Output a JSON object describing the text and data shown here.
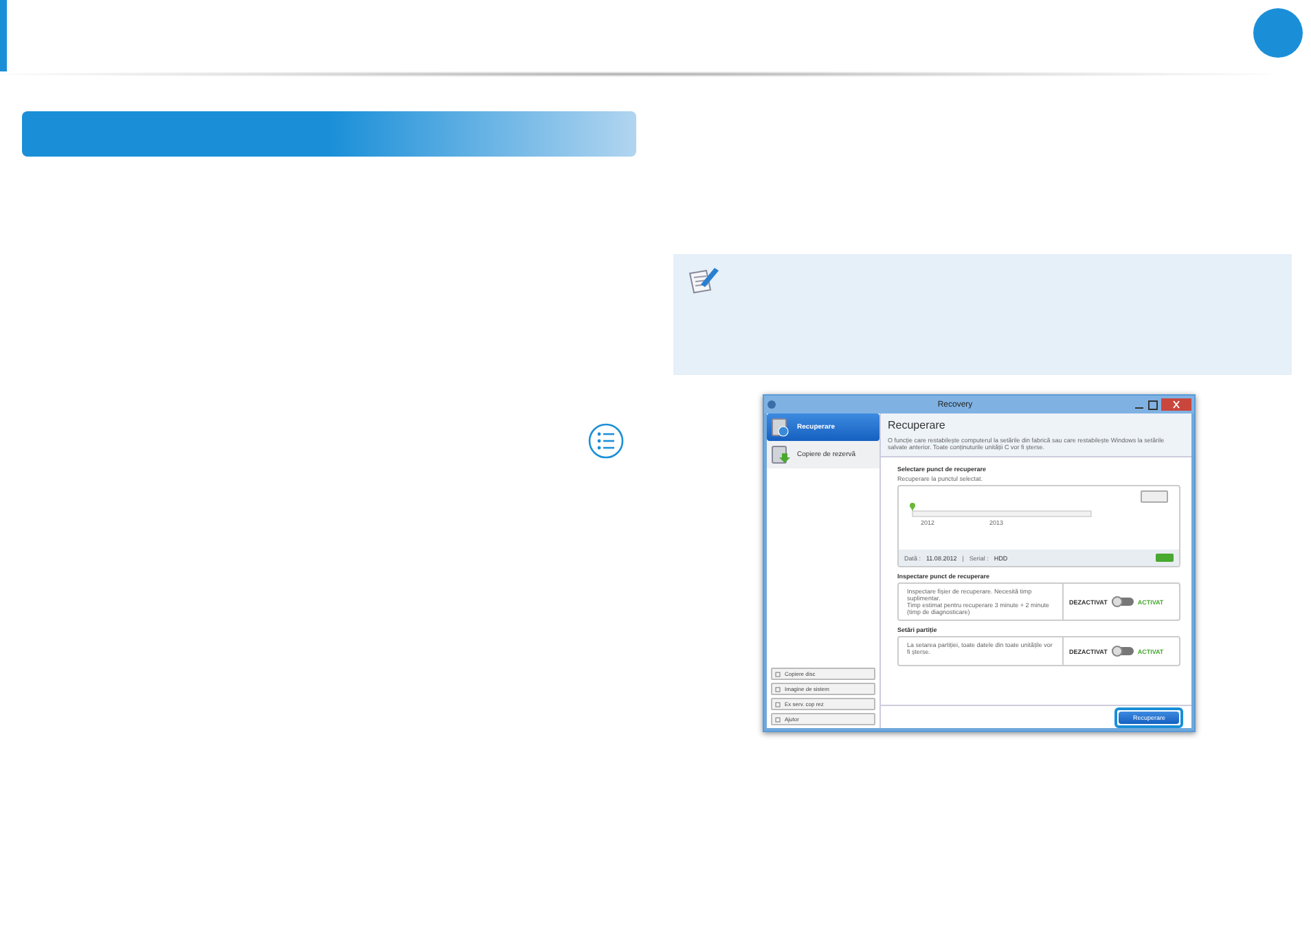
{
  "window": {
    "title": "Recovery"
  },
  "sidebar": {
    "items": [
      {
        "label": "Recuperare",
        "selected": true
      },
      {
        "label": "Copiere de rezervă",
        "selected": false
      }
    ],
    "buttons": [
      "Copiere disc",
      "Imagine de sistem",
      "Ex serv. cop rez",
      "Ajutor"
    ]
  },
  "header": {
    "title": "Recuperare",
    "description": "O funcție care restabilește computerul la setările din fabrică sau care restabilește Windows la setările salvate anterior. Toate conținuturile unității C vor fi șterse."
  },
  "restore_point": {
    "title": "Selectare punct de recuperare",
    "subtitle": "Recuperare la punctul selectat.",
    "years": [
      "2012",
      "2013"
    ],
    "date_label": "Dată :",
    "date": "11.08.2012",
    "separator": "|",
    "level": 0,
    "serial_label": "Serial :",
    "serial": "HDD"
  },
  "options": [
    {
      "title": "Inspectare punct de recuperare",
      "text": "Inspectare fișier de recuperare. Necesită timp suplimentar.\nTimp estimat pentru recuperare 3 minute + 2 minute (timp de diagnosticare)",
      "off_label": "DEZACTIVAT",
      "on_label": "ACTIVAT",
      "on": false
    },
    {
      "title": "Setări partiție",
      "text": "La setarea partiției, toate datele din toate unitățile vor fi șterse.",
      "off_label": "DEZACTIVAT",
      "on_label": "ACTIVAT",
      "on": false
    }
  ],
  "action_button": "Recuperare"
}
